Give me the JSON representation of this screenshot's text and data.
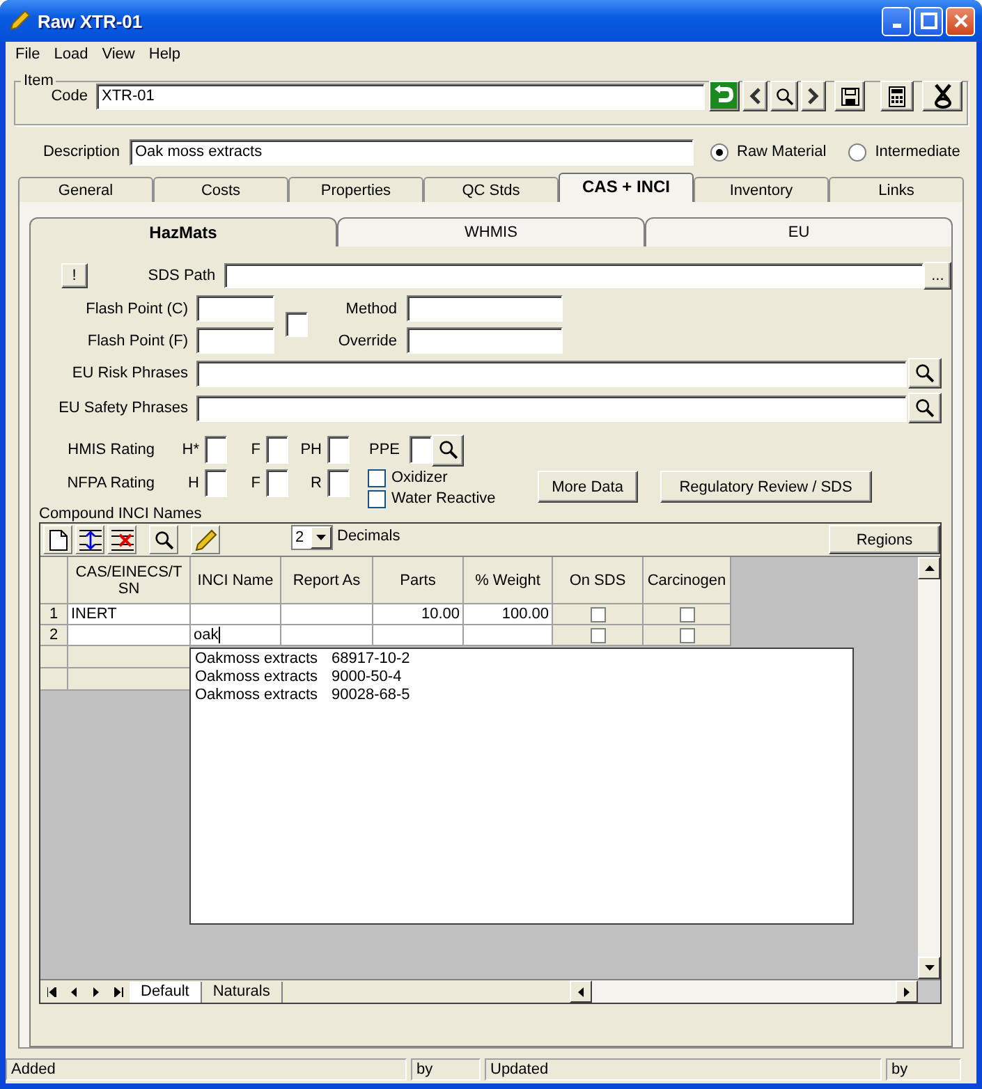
{
  "window": {
    "title": "Raw XTR-01"
  },
  "menu": [
    "File",
    "Load",
    "View",
    "Help"
  ],
  "item": {
    "legend": "Item",
    "code_label": "Code",
    "code": "XTR-01"
  },
  "description": {
    "label": "Description",
    "value": "Oak moss extracts"
  },
  "material_type": [
    {
      "label": "Raw Material",
      "selected": true
    },
    {
      "label": "Intermediate",
      "selected": false
    }
  ],
  "tabs": [
    {
      "label": "General",
      "selected": false
    },
    {
      "label": "Costs",
      "selected": false
    },
    {
      "label": "Properties",
      "selected": false
    },
    {
      "label": "QC Stds",
      "selected": false
    },
    {
      "label": "CAS + INCI",
      "selected": true
    },
    {
      "label": "Inventory",
      "selected": false
    },
    {
      "label": "Links",
      "selected": false
    }
  ],
  "subtabs": [
    {
      "label": "HazMats",
      "selected": true
    },
    {
      "label": "WHMIS",
      "selected": false
    },
    {
      "label": "EU",
      "selected": false
    }
  ],
  "hazmats": {
    "alert_button": "!",
    "sds_path_label": "SDS Path",
    "browse_button": "...",
    "flash_point_c_label": "Flash Point (C)",
    "flash_point_f_label": "Flash Point (F)",
    "flash_point_checked": false,
    "method_label": "Method",
    "override_label": "Override",
    "eu_risk_label": "EU Risk Phrases",
    "eu_safety_label": "EU Safety Phrases",
    "hmis": {
      "label": "HMIS Rating",
      "fields": [
        "H*",
        "F",
        "PH"
      ],
      "ppe_label": "PPE"
    },
    "nfpa": {
      "label": "NFPA Rating",
      "fields": [
        "H",
        "F",
        "R"
      ]
    },
    "flags": [
      {
        "label": "Oxidizer",
        "checked": false
      },
      {
        "label": "Water Reactive",
        "checked": false
      }
    ],
    "buttons": [
      "More Data",
      "Regulatory Review / SDS"
    ]
  },
  "compound": {
    "title": "Compound INCI Names",
    "decimals": "2",
    "decimals_label": "Decimals",
    "regions_button": "Regions"
  },
  "grid": {
    "columns": [
      "CAS/EINECS/TSN",
      "INCI Name",
      "Report As",
      "Parts",
      "% Weight",
      "On SDS",
      "Carcinogen"
    ],
    "rows": [
      {
        "number": "1",
        "cas": "INERT",
        "parts": "10.00",
        "weight": "100.00",
        "on_sds": false,
        "carcinogen": false
      },
      {
        "number": "2",
        "inci": "oak",
        "on_sds": false,
        "carcinogen": false
      }
    ]
  },
  "suggestions": [
    {
      "name": "Oakmoss extracts",
      "cas": "68917-10-2"
    },
    {
      "name": "Oakmoss extracts",
      "cas": "9000-50-4"
    },
    {
      "name": "Oakmoss extracts",
      "cas": "90028-68-5"
    }
  ],
  "sheets": [
    {
      "label": "Default",
      "selected": true
    },
    {
      "label": "Naturals",
      "selected": false
    }
  ],
  "status_bar": [
    "Added",
    "by",
    "Updated",
    "by"
  ]
}
